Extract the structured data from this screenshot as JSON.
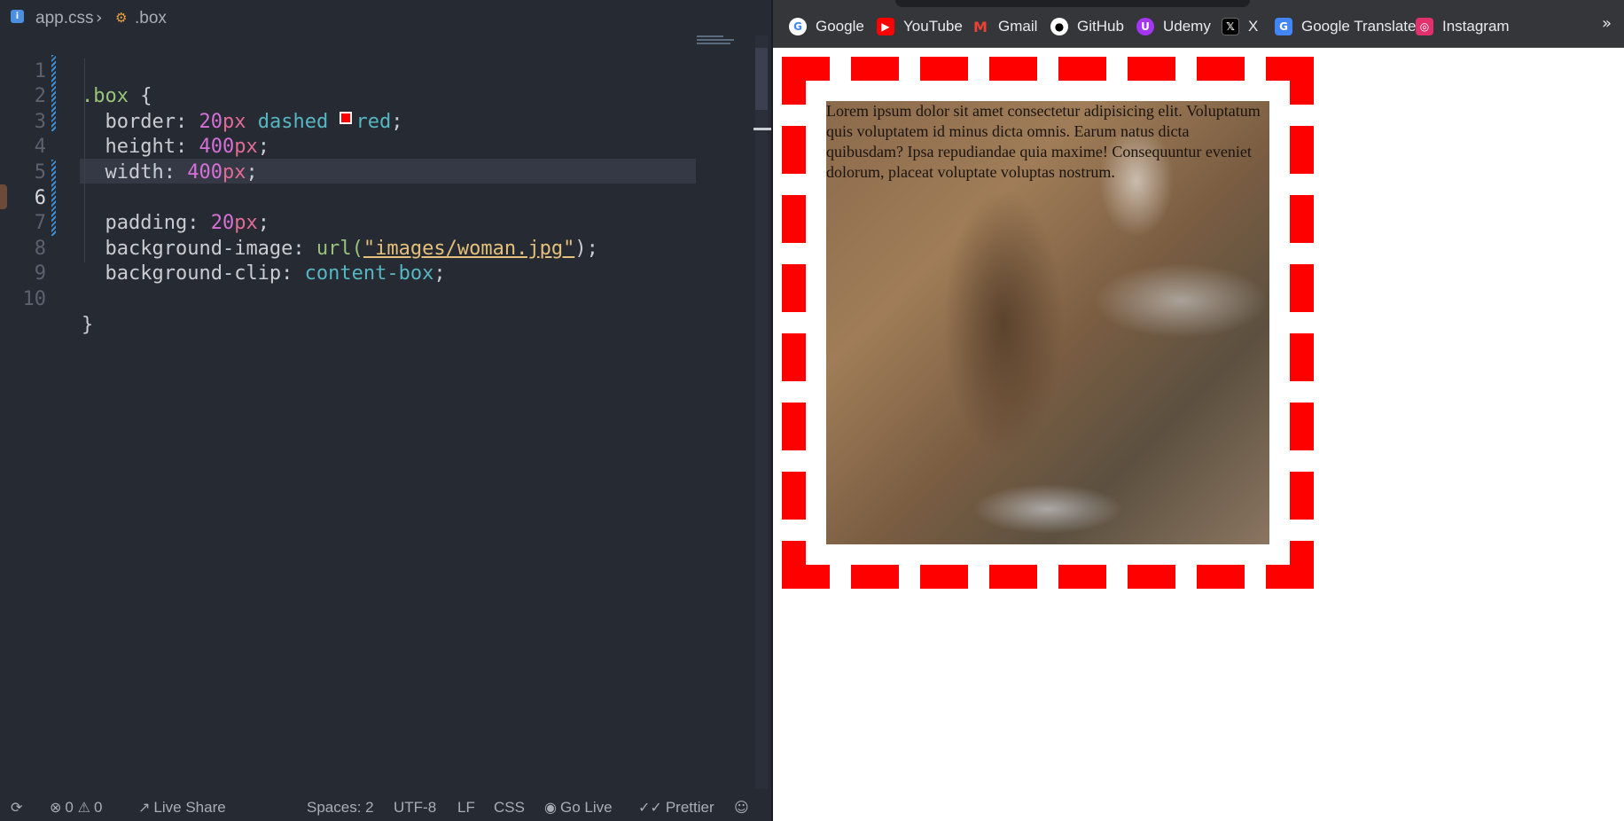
{
  "editor": {
    "breadcrumb": {
      "file": "app.css",
      "symbol": ".box"
    },
    "lines": [
      {
        "num": "1"
      },
      {
        "num": "2"
      },
      {
        "num": "3"
      },
      {
        "num": "4"
      },
      {
        "num": "5"
      },
      {
        "num": "6"
      },
      {
        "num": "7"
      },
      {
        "num": "8"
      },
      {
        "num": "9"
      },
      {
        "num": "10"
      }
    ],
    "code": {
      "selector": ".box",
      "open_brace": "{",
      "close_brace": "}",
      "border_prop": "border:",
      "border_num": "20",
      "border_unit": "px",
      "border_style": "dashed",
      "border_color": "red",
      "height_prop": "height:",
      "height_num": "400",
      "height_unit": "px",
      "width_prop": "width:",
      "width_num": "400",
      "width_unit": "px",
      "padding_prop": "padding:",
      "padding_num": "20",
      "padding_unit": "px",
      "bgimg_prop": "background-image:",
      "bgimg_fn": "url(",
      "bgimg_str": "\"images/woman.jpg\"",
      "bgimg_end": ");",
      "bgclip_prop": "background-clip:",
      "bgclip_val": "content-box",
      "semicolon": ";"
    },
    "active_line": "6"
  },
  "statusbar": {
    "errors": "0",
    "warnings": "0",
    "live_share": "Live Share",
    "spaces": "Spaces: 2",
    "encoding": "UTF-8",
    "eol": "LF",
    "language": "CSS",
    "go_live": "Go Live",
    "prettier": "Prettier"
  },
  "browser": {
    "bookmarks": [
      {
        "label": "Google",
        "icon": "google-icon",
        "color": "#ffffff"
      },
      {
        "label": "YouTube",
        "icon": "youtube-icon",
        "color": "#ff0000"
      },
      {
        "label": "Gmail",
        "icon": "gmail-icon",
        "color": "#ea4335"
      },
      {
        "label": "GitHub",
        "icon": "github-icon",
        "color": "#ffffff"
      },
      {
        "label": "Udemy",
        "icon": "udemy-icon",
        "color": "#a435f0"
      },
      {
        "label": "X",
        "icon": "x-icon",
        "color": "#000000"
      },
      {
        "label": "Google Translate",
        "icon": "translate-icon",
        "color": "#4285f4"
      },
      {
        "label": "Instagram",
        "icon": "instagram-icon",
        "color": "#e1306c"
      }
    ],
    "more": "»",
    "box_text": "Lorem ipsum dolor sit amet consectetur adipisicing elit. Voluptatum quis voluptatem id minus dicta omnis. Earum natus dicta quibusdam? Ipsa repudiandae quia maxime! Consequuntur eveniet dolorum, placeat voluptate voluptas nostrum."
  },
  "colors": {
    "editor_bg": "#262a33",
    "border_red": "#ff0000",
    "bookmark_bar": "#35363a"
  }
}
